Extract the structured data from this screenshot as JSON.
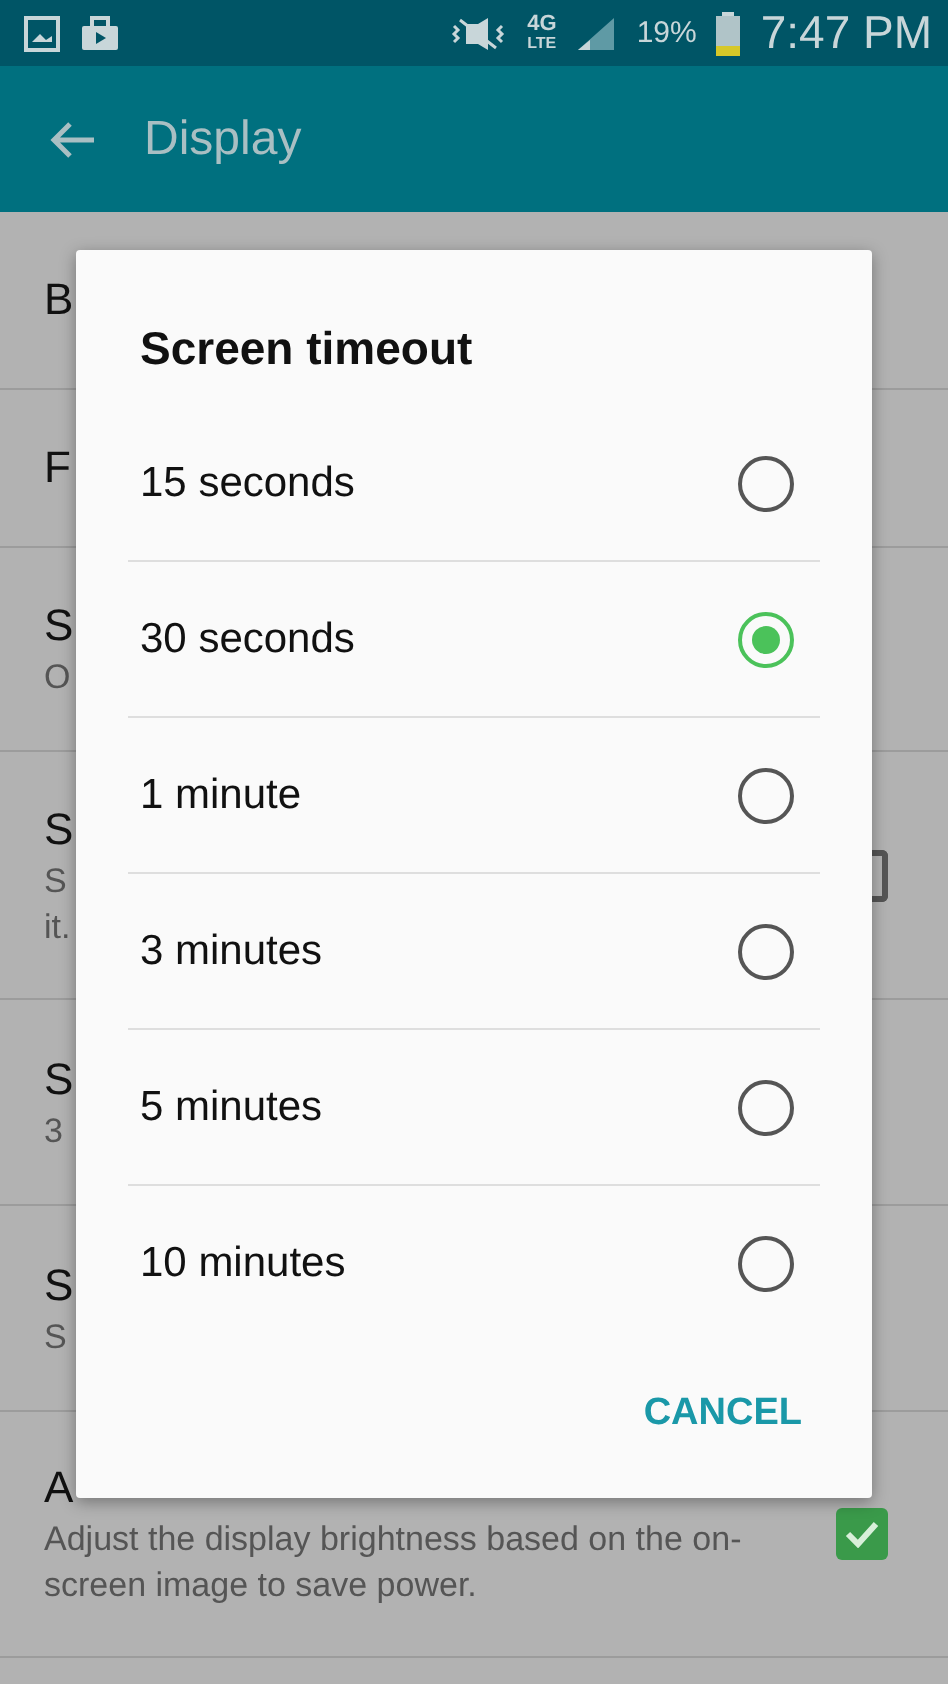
{
  "status_bar": {
    "network": "4G",
    "network_sub": "LTE",
    "battery": "19%",
    "time": "7:47 PM"
  },
  "app_bar": {
    "title": "Display"
  },
  "settings": [
    {
      "title": "B",
      "kind": "plain"
    },
    {
      "title": "F",
      "kind": "plain"
    },
    {
      "title": "S",
      "subtitle": [
        "O"
      ],
      "kind": "plain"
    },
    {
      "title": "S",
      "subtitle": [
        "S",
        "it."
      ],
      "kind": "checkbox",
      "checked": false
    },
    {
      "title": "S",
      "subtitle": [
        "3"
      ],
      "kind": "plain"
    },
    {
      "title": "S",
      "subtitle": [
        "S"
      ],
      "kind": "plain"
    },
    {
      "title": "A",
      "subtitle": [
        "Adjust the display brightness based on the on-",
        "screen image to save power."
      ],
      "kind": "checkbox",
      "checked": true
    }
  ],
  "dialog": {
    "title": "Screen timeout",
    "options": [
      {
        "label": "15 seconds",
        "selected": false
      },
      {
        "label": "30 seconds",
        "selected": true
      },
      {
        "label": "1 minute",
        "selected": false
      },
      {
        "label": "3 minutes",
        "selected": false
      },
      {
        "label": "5 minutes",
        "selected": false
      },
      {
        "label": "10 minutes",
        "selected": false
      }
    ],
    "cancel": "CANCEL"
  }
}
